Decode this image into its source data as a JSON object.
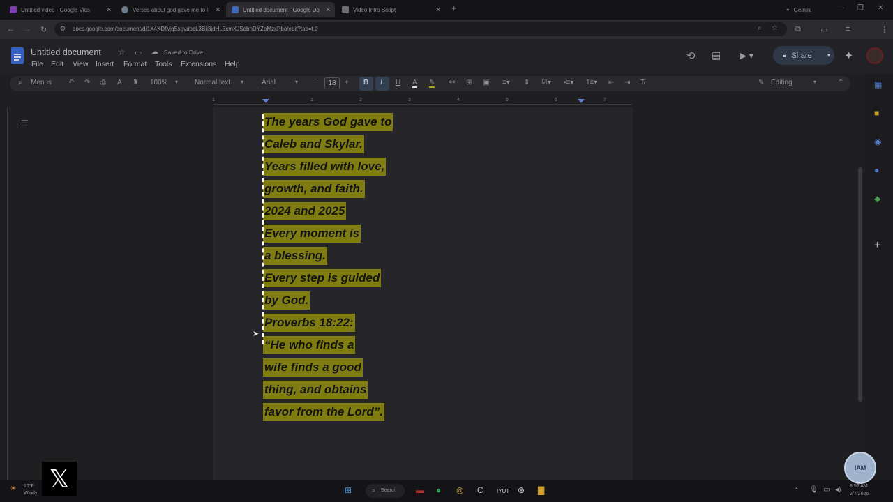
{
  "browser": {
    "tabs": [
      {
        "title": "Untitled video - Google Vids",
        "color": "#7b3fb2"
      },
      {
        "title": "Verses about god gave me to l",
        "color": "#6c7a89"
      },
      {
        "title": "Untitled document - Google Do",
        "color": "#3e64b5",
        "active": true
      },
      {
        "title": "Video Intro Script",
        "color": "#6c6c72"
      }
    ],
    "gemini_label": "Gemini",
    "url": "docs.google.com/document/d/1X4XDfMqSxgvdocL3Bii3jdHL5xmXJSdbnDYZpMzxPbo/edit?tab=t.0"
  },
  "docs": {
    "title": "Untitled document",
    "saved_status": "Saved to Drive",
    "menus": [
      "File",
      "Edit",
      "View",
      "Insert",
      "Format",
      "Tools",
      "Extensions",
      "Help"
    ],
    "share_label": "Share",
    "toolbar": {
      "menus_label": "Menus",
      "zoom": "100%",
      "style": "Normal text",
      "font": "Arial",
      "font_size": "18",
      "mode": "Editing"
    },
    "ruler_numbers": [
      "1",
      "1",
      "2",
      "3",
      "4",
      "5",
      "6",
      "7"
    ],
    "content_lines": [
      " The years God gave to",
      " Caleb and Skylar.",
      "Years filled with love,",
      "growth, and faith.",
      "2024 and 2025",
      "Every moment is",
      " a blessing.",
      "Every step is guided",
      "by God.",
      "Proverbs 18:22:",
      "“He who finds a",
      "wife finds a good",
      "thing, and obtains",
      "favor from the Lord”."
    ],
    "highlight_color": "#7f7c12"
  },
  "taskbar": {
    "weather_temp": "16°F",
    "weather_desc": "Windy",
    "search_label": "Search",
    "time": "8:52 AM",
    "date": "2/7/2026"
  },
  "overlay": {
    "badge_text": "IAM"
  }
}
